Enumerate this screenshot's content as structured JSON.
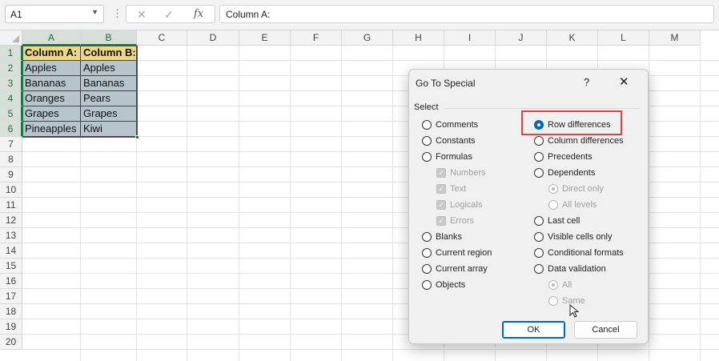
{
  "formula_bar": {
    "name_box": "A1",
    "dots": "⋮",
    "cancel_icon": "✕",
    "enter_icon": "✓",
    "fx_label": "fx",
    "formula": "Column A:"
  },
  "columns": [
    "A",
    "B",
    "C",
    "D",
    "E",
    "F",
    "G",
    "H",
    "I",
    "J",
    "K",
    "L",
    "M"
  ],
  "rows": [
    "1",
    "2",
    "3",
    "4",
    "5",
    "6",
    "7",
    "8",
    "9",
    "10",
    "11",
    "12",
    "13",
    "14",
    "15",
    "16",
    "17",
    "18",
    "19",
    "20"
  ],
  "cells": {
    "a": [
      "Column A:",
      "Apples",
      "Bananas",
      "Oranges",
      "Grapes",
      "Pineapples"
    ],
    "b": [
      "Column B:",
      "Apples",
      "Bananas",
      "Pears",
      "Grapes",
      "Kiwi"
    ]
  },
  "dialog": {
    "title": "Go To Special",
    "help": "?",
    "close": "✕",
    "select_label": "Select",
    "left_options": [
      {
        "label": "Comments",
        "state": "off"
      },
      {
        "label": "Constants",
        "state": "off"
      },
      {
        "label": "Formulas",
        "state": "off"
      },
      {
        "label": "Numbers",
        "state": "checkbox-disabled"
      },
      {
        "label": "Text",
        "state": "checkbox-disabled"
      },
      {
        "label": "Logicals",
        "state": "checkbox-disabled"
      },
      {
        "label": "Errors",
        "state": "checkbox-disabled"
      },
      {
        "label": "Blanks",
        "state": "off"
      },
      {
        "label": "Current region",
        "state": "off"
      },
      {
        "label": "Current array",
        "state": "off"
      },
      {
        "label": "Objects",
        "state": "off"
      }
    ],
    "right_options": [
      {
        "label": "Row differences",
        "state": "on"
      },
      {
        "label": "Column differences",
        "state": "off"
      },
      {
        "label": "Precedents",
        "state": "off"
      },
      {
        "label": "Dependents",
        "state": "off"
      },
      {
        "label": "Direct only",
        "state": "disabled-on"
      },
      {
        "label": "All levels",
        "state": "disabled"
      },
      {
        "label": "Last cell",
        "state": "off"
      },
      {
        "label": "Visible cells only",
        "state": "off"
      },
      {
        "label": "Conditional formats",
        "state": "off"
      },
      {
        "label": "Data validation",
        "state": "off"
      },
      {
        "label": "All",
        "state": "disabled-on"
      },
      {
        "label": "Same",
        "state": "disabled"
      }
    ],
    "ok_label": "OK",
    "cancel_label": "Cancel"
  },
  "colors": {
    "accent_green": "#217346",
    "header_fill": "#efd78a",
    "selection_fill": "#b6c4cc",
    "highlight_box": "#d9434a",
    "radio_selected": "#0067c0"
  }
}
